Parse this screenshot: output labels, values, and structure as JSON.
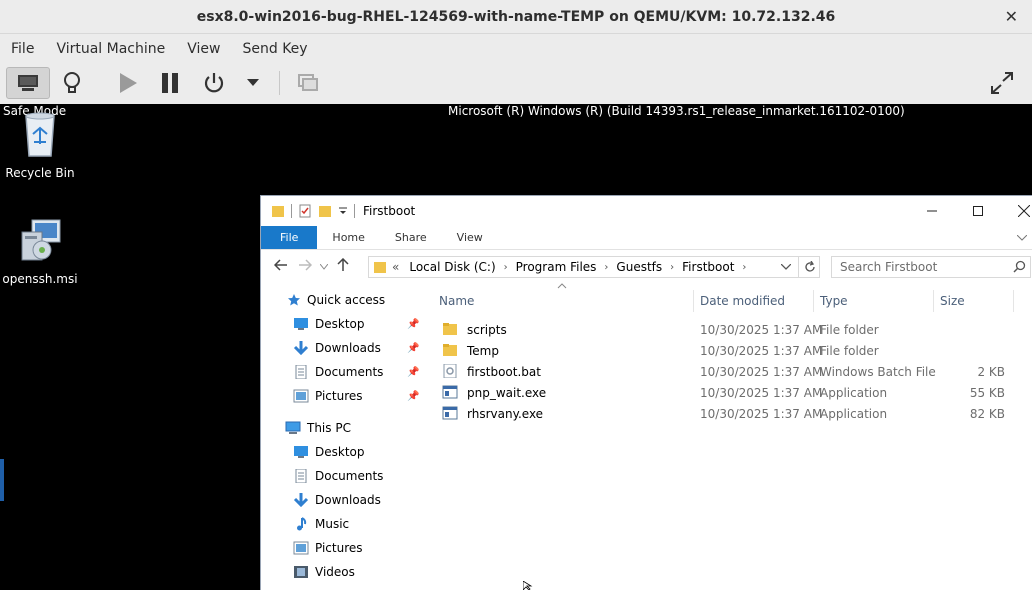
{
  "window": {
    "title": "esx8.0-win2016-bug-RHEL-124569-with-name-TEMP on QEMU/KVM: 10.72.132.46",
    "close_glyph": "✕"
  },
  "menubar": [
    "File",
    "Virtual Machine",
    "View",
    "Send Key"
  ],
  "toolbar": {
    "icons": [
      "monitor-icon",
      "lightbulb-icon",
      "play-icon",
      "pause-icon",
      "power-icon",
      "chevron-down-icon",
      "clone-icon",
      "fullscreen-icon"
    ]
  },
  "guest": {
    "safe_mode": "Safe Mode",
    "build_text": "Microsoft (R) Windows (R) (Build 14393.rs1_release_inmarket.161102-0100)",
    "desktop_icons": [
      {
        "label": "Recycle Bin",
        "icon": "recycle-bin-icon"
      },
      {
        "label": "openssh.msi",
        "icon": "installer-icon"
      }
    ]
  },
  "explorer": {
    "title": "Firstboot",
    "ribbon_tabs": [
      "File",
      "Home",
      "Share",
      "View"
    ],
    "address": {
      "prefix": "«",
      "crumbs": [
        "Local Disk (C:)",
        "Program Files",
        "Guestfs",
        "Firstboot"
      ]
    },
    "search_placeholder": "Search Firstboot",
    "nav": [
      {
        "label": "Quick access",
        "icon": "star-icon",
        "indent": 0,
        "pinned": false
      },
      {
        "label": "Desktop",
        "icon": "desktop-icon",
        "indent": 1,
        "pinned": true
      },
      {
        "label": "Downloads",
        "icon": "download-icon",
        "indent": 1,
        "pinned": true
      },
      {
        "label": "Documents",
        "icon": "document-icon",
        "indent": 1,
        "pinned": true
      },
      {
        "label": "Pictures",
        "icon": "pictures-icon",
        "indent": 1,
        "pinned": true
      },
      {
        "label": "This PC",
        "icon": "computer-icon",
        "indent": 0,
        "pinned": false
      },
      {
        "label": "Desktop",
        "icon": "desktop-icon",
        "indent": 1,
        "pinned": false
      },
      {
        "label": "Documents",
        "icon": "document-icon",
        "indent": 1,
        "pinned": false
      },
      {
        "label": "Downloads",
        "icon": "download-icon",
        "indent": 1,
        "pinned": false
      },
      {
        "label": "Music",
        "icon": "music-icon",
        "indent": 1,
        "pinned": false
      },
      {
        "label": "Pictures",
        "icon": "pictures-icon",
        "indent": 1,
        "pinned": false
      },
      {
        "label": "Videos",
        "icon": "videos-icon",
        "indent": 1,
        "pinned": false
      }
    ],
    "columns": [
      "Name",
      "Date modified",
      "Type",
      "Size"
    ],
    "files": [
      {
        "name": "scripts",
        "date": "10/30/2025 1:37 AM",
        "type": "File folder",
        "size": "",
        "icon": "folder-icon"
      },
      {
        "name": "Temp",
        "date": "10/30/2025 1:37 AM",
        "type": "File folder",
        "size": "",
        "icon": "folder-icon"
      },
      {
        "name": "firstboot.bat",
        "date": "10/30/2025 1:37 AM",
        "type": "Windows Batch File",
        "size": "2 KB",
        "icon": "batch-file-icon"
      },
      {
        "name": "pnp_wait.exe",
        "date": "10/30/2025 1:37 AM",
        "type": "Application",
        "size": "55 KB",
        "icon": "exe-icon"
      },
      {
        "name": "rhsrvany.exe",
        "date": "10/30/2025 1:37 AM",
        "type": "Application",
        "size": "82 KB",
        "icon": "exe-icon"
      }
    ]
  },
  "colors": {
    "ribbon_file_tab": "#1979ca",
    "folder_yellow": "#f0c44a",
    "header_text": "#4c607a"
  }
}
